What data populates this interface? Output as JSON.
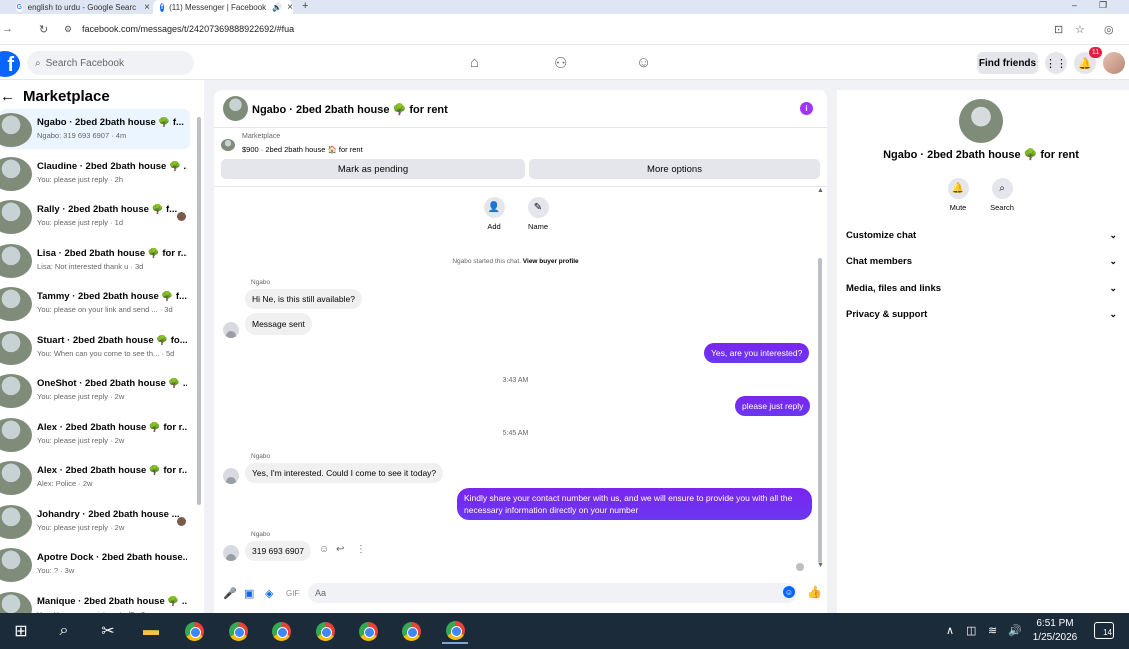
{
  "browser": {
    "tabs": [
      {
        "title": "english to urdu - Google Searc",
        "favicon": "G"
      },
      {
        "title": "(11) Messenger | Facebook",
        "favicon": "f"
      }
    ],
    "url": "facebook.com/messages/t/24207369888922692/#fua"
  },
  "header": {
    "search_placeholder": "Search Facebook",
    "find_friends": "Find friends",
    "notification_count": "11"
  },
  "left": {
    "title": "Marketplace",
    "conversations": [
      {
        "name": "Ngabo · 2bed 2bath house 🌳 f...",
        "snippet": "Ngabo: 319 693 6907 · 4m",
        "active": true
      },
      {
        "name": "Claudine · 2bed 2bath house 🌳 ...",
        "snippet": "You: please just reply · 2h"
      },
      {
        "name": "Rally · 2bed 2bath house 🌳 f...",
        "snippet": "You: please just reply · 1d",
        "dot": true
      },
      {
        "name": "Lisa · 2bed 2bath house 🌳 for r...",
        "snippet": "Lisa: Not interested thank u · 3d"
      },
      {
        "name": "Tammy · 2bed 2bath house 🌳 f...",
        "snippet": "You: please on your link and send ... · 3d"
      },
      {
        "name": "Stuart · 2bed 2bath house 🌳 fo...",
        "snippet": "You: When can you come to see th... · 5d"
      },
      {
        "name": "OneShot · 2bed 2bath house 🌳 ...",
        "snippet": "You: please just reply · 2w"
      },
      {
        "name": "Alex · 2bed 2bath house 🌳 for r...",
        "snippet": "You: please just reply · 2w"
      },
      {
        "name": "Alex · 2bed 2bath house 🌳 for r...",
        "snippet": "Alex: Police · 2w"
      },
      {
        "name": "Johandry · 2bed 2bath house ...",
        "snippet": "You: please just reply · 2w",
        "dot": true
      },
      {
        "name": "Apotre Dock · 2bed 2bath house...",
        "snippet": "You: ? · 3w"
      },
      {
        "name": "Manique · 2bed 2bath house 🌳 ...",
        "snippet": "You: Yes, are you interested? · 3w"
      }
    ]
  },
  "chat": {
    "title": "Ngabo · 2bed 2bath house 🌳 for rent",
    "marketplace_label": "Marketplace",
    "listing": "$900 · 2bed 2bath house 🏠 for rent",
    "mark_pending": "Mark as pending",
    "more_options": "More options",
    "add_label": "Add",
    "name_label": "Name",
    "started_text": "Ngabo started this chat.",
    "view_profile": "View buyer profile",
    "sender": "Ngabo",
    "msg_in_1": "Hi Ne, is this still available?",
    "msg_in_2": "Message sent",
    "msg_out_1": "Yes, are you interested?",
    "time_1": "3:43 AM",
    "msg_out_2": "please just reply",
    "time_2": "5:45 AM",
    "msg_in_3": "Yes, I'm interested. Could I come to see it today?",
    "msg_out_3": "Kindly share your contact number with us, and we will ensure to provide you with all the necessary information directly on your number",
    "msg_in_4": "319 693 6907",
    "composer_placeholder": "Aa"
  },
  "right": {
    "name": "Ngabo · 2bed 2bath house 🌳 for rent",
    "mute": "Mute",
    "search": "Search",
    "rows": [
      "Customize chat",
      "Chat members",
      "Media, files and links",
      "Privacy & support"
    ]
  },
  "taskbar": {
    "time": "6:51 PM",
    "date": "1/25/2026",
    "notif_count": "14"
  },
  "colors": {
    "accent_purple": "#7a25f0",
    "fb_blue": "#0866ff",
    "badge_red": "#e41e3f"
  }
}
